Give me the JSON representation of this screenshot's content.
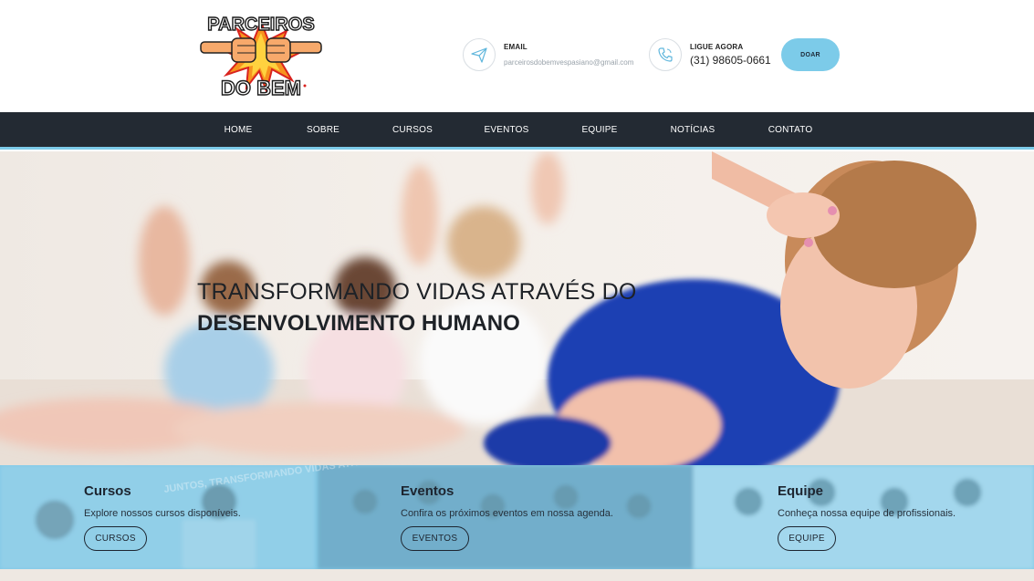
{
  "header": {
    "logo": {
      "top_text": "PARCEIROS",
      "bottom_text": "DO BEM"
    },
    "email": {
      "label": "EMAIL",
      "value": "parceirosdobemvespasiano@gmail.com",
      "icon": "paper-plane-icon"
    },
    "phone": {
      "label": "LIGUE AGORA",
      "value": "(31) 98605-0661",
      "icon": "phone-icon"
    },
    "donate_label": "DOAR"
  },
  "nav": {
    "items": [
      {
        "label": "HOME"
      },
      {
        "label": "SOBRE"
      },
      {
        "label": "CURSOS"
      },
      {
        "label": "EVENTOS"
      },
      {
        "label": "EQUIPE"
      },
      {
        "label": "NOTÍCIAS"
      },
      {
        "label": "CONTATO"
      }
    ]
  },
  "hero": {
    "line1": "TRANSFORMANDO VIDAS ATRAVÉS DO",
    "line2": "DESENVOLVIMENTO HUMANO"
  },
  "cards": [
    {
      "title": "Cursos",
      "description": "Explore nossos cursos disponíveis.",
      "button": "CURSOS",
      "background_text": "JUNTOS, TRANSFORMANDO VIDAS ATRAVÉS DA EDUCAÇÃO"
    },
    {
      "title": "Eventos",
      "description": "Confira os próximos eventos em nossa agenda.",
      "button": "EVENTOS"
    },
    {
      "title": "Equipe",
      "description": "Conheça nossa equipe de profissionais.",
      "button": "EQUIPE"
    }
  ],
  "colors": {
    "accent": "#7ccbe9",
    "nav_bg": "#232a33",
    "text_dark": "#1e2227",
    "card_overlay": "#80c8e6"
  }
}
